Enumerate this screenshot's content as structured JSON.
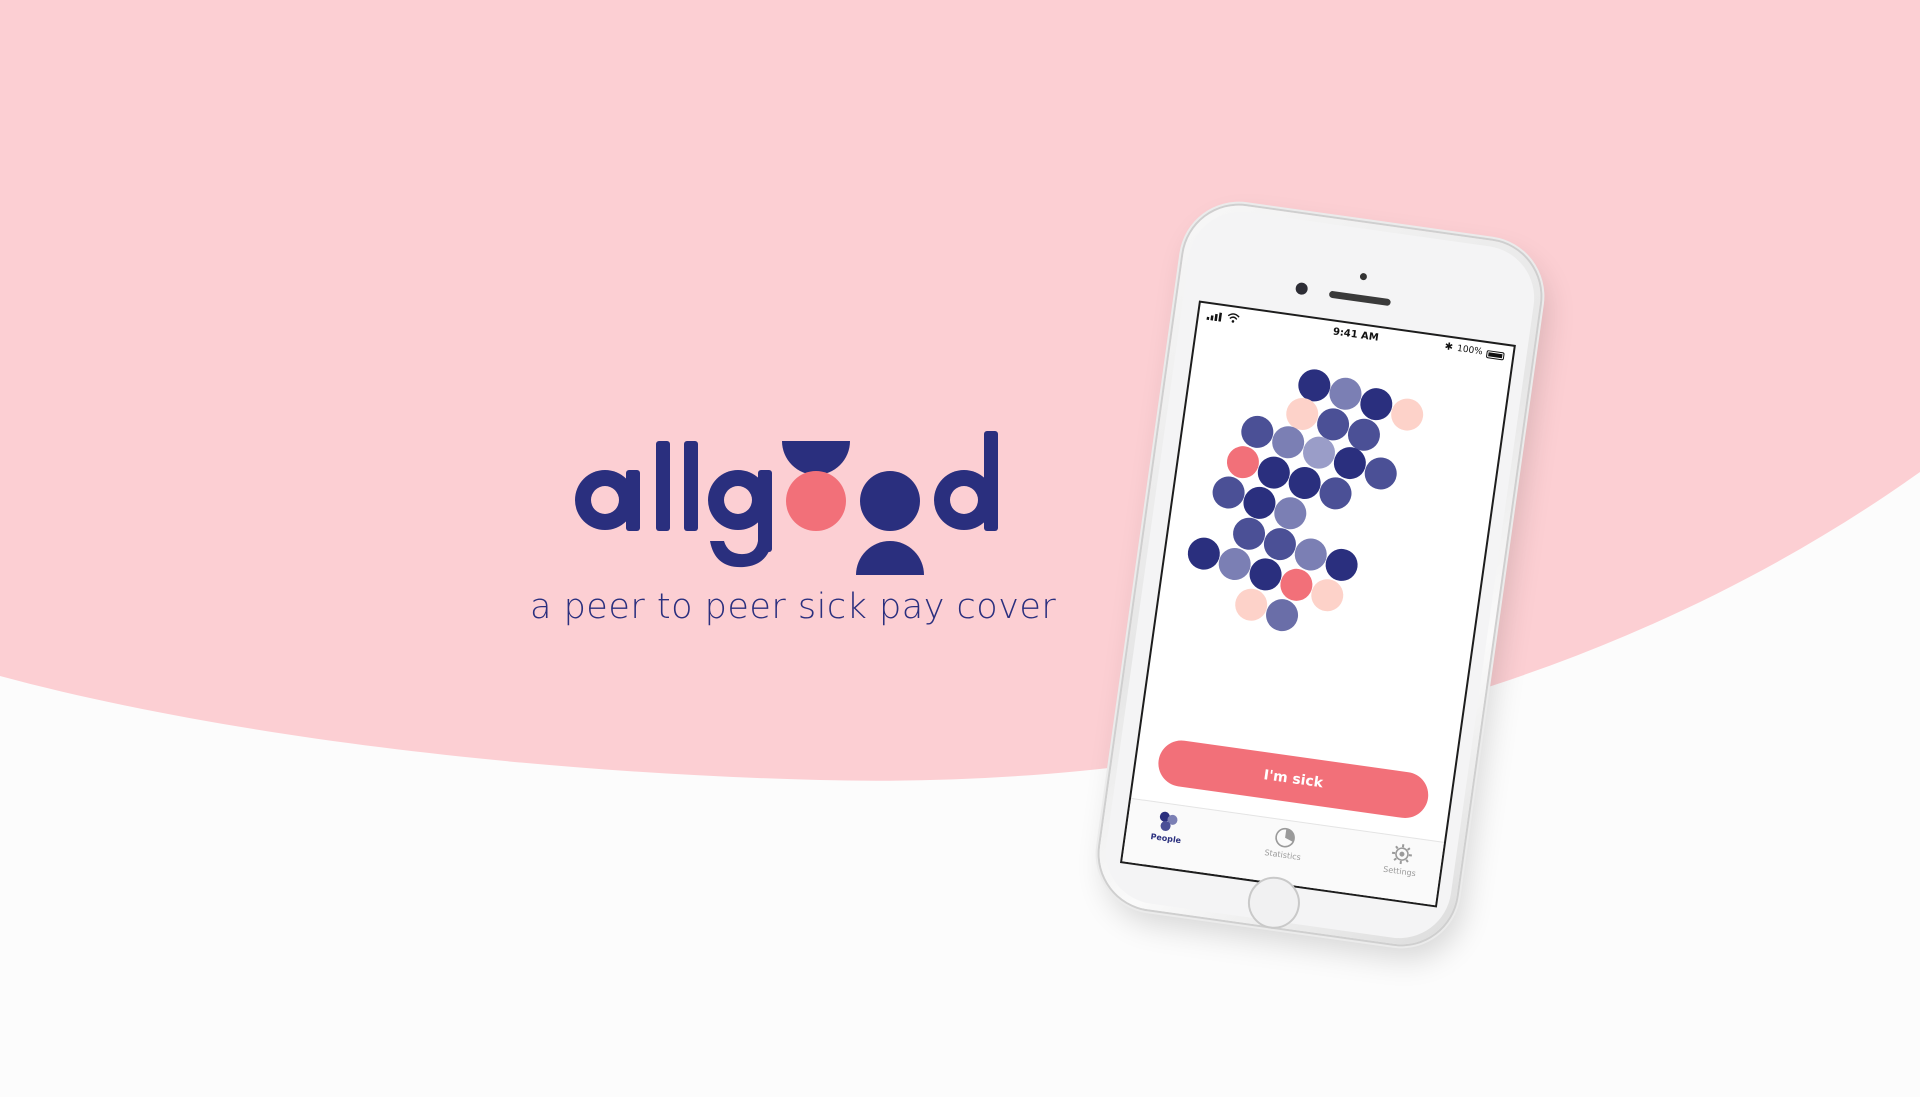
{
  "brand": {
    "tagline": "a peer to peer sick pay cover",
    "logo_wordmark": "allgood"
  },
  "colors": {
    "background_pink": "#fccfd3",
    "background_white": "#fcfcfc",
    "navy": "#2a2f7e",
    "coral": "#f27079",
    "peach": "#fdd2c9",
    "lavender": "#7b7fb4"
  },
  "phone": {
    "status_bar": {
      "time": "9:41 AM",
      "battery": "100%",
      "icons": [
        "signal-icon",
        "wifi-icon",
        "bluetooth-icon",
        "battery-icon"
      ]
    },
    "primary_button_label": "I'm sick",
    "tabs": [
      {
        "label": "People",
        "icon": "people-icon",
        "active": true
      },
      {
        "label": "Statistics",
        "icon": "pie-chart-icon",
        "active": false
      },
      {
        "label": "Settings",
        "icon": "gear-icon",
        "active": false
      }
    ]
  }
}
